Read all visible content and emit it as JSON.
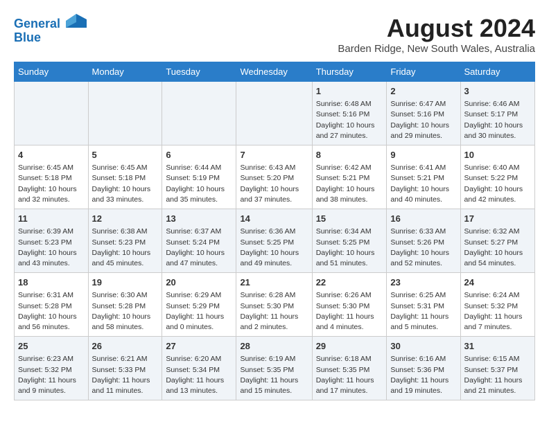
{
  "header": {
    "logo_line1": "General",
    "logo_line2": "Blue",
    "month_year": "August 2024",
    "location": "Barden Ridge, New South Wales, Australia"
  },
  "weekdays": [
    "Sunday",
    "Monday",
    "Tuesday",
    "Wednesday",
    "Thursday",
    "Friday",
    "Saturday"
  ],
  "weeks": [
    [
      {
        "day": "",
        "content": ""
      },
      {
        "day": "",
        "content": ""
      },
      {
        "day": "",
        "content": ""
      },
      {
        "day": "",
        "content": ""
      },
      {
        "day": "1",
        "content": "Sunrise: 6:48 AM\nSunset: 5:16 PM\nDaylight: 10 hours\nand 27 minutes."
      },
      {
        "day": "2",
        "content": "Sunrise: 6:47 AM\nSunset: 5:16 PM\nDaylight: 10 hours\nand 29 minutes."
      },
      {
        "day": "3",
        "content": "Sunrise: 6:46 AM\nSunset: 5:17 PM\nDaylight: 10 hours\nand 30 minutes."
      }
    ],
    [
      {
        "day": "4",
        "content": "Sunrise: 6:45 AM\nSunset: 5:18 PM\nDaylight: 10 hours\nand 32 minutes."
      },
      {
        "day": "5",
        "content": "Sunrise: 6:45 AM\nSunset: 5:18 PM\nDaylight: 10 hours\nand 33 minutes."
      },
      {
        "day": "6",
        "content": "Sunrise: 6:44 AM\nSunset: 5:19 PM\nDaylight: 10 hours\nand 35 minutes."
      },
      {
        "day": "7",
        "content": "Sunrise: 6:43 AM\nSunset: 5:20 PM\nDaylight: 10 hours\nand 37 minutes."
      },
      {
        "day": "8",
        "content": "Sunrise: 6:42 AM\nSunset: 5:21 PM\nDaylight: 10 hours\nand 38 minutes."
      },
      {
        "day": "9",
        "content": "Sunrise: 6:41 AM\nSunset: 5:21 PM\nDaylight: 10 hours\nand 40 minutes."
      },
      {
        "day": "10",
        "content": "Sunrise: 6:40 AM\nSunset: 5:22 PM\nDaylight: 10 hours\nand 42 minutes."
      }
    ],
    [
      {
        "day": "11",
        "content": "Sunrise: 6:39 AM\nSunset: 5:23 PM\nDaylight: 10 hours\nand 43 minutes."
      },
      {
        "day": "12",
        "content": "Sunrise: 6:38 AM\nSunset: 5:23 PM\nDaylight: 10 hours\nand 45 minutes."
      },
      {
        "day": "13",
        "content": "Sunrise: 6:37 AM\nSunset: 5:24 PM\nDaylight: 10 hours\nand 47 minutes."
      },
      {
        "day": "14",
        "content": "Sunrise: 6:36 AM\nSunset: 5:25 PM\nDaylight: 10 hours\nand 49 minutes."
      },
      {
        "day": "15",
        "content": "Sunrise: 6:34 AM\nSunset: 5:25 PM\nDaylight: 10 hours\nand 51 minutes."
      },
      {
        "day": "16",
        "content": "Sunrise: 6:33 AM\nSunset: 5:26 PM\nDaylight: 10 hours\nand 52 minutes."
      },
      {
        "day": "17",
        "content": "Sunrise: 6:32 AM\nSunset: 5:27 PM\nDaylight: 10 hours\nand 54 minutes."
      }
    ],
    [
      {
        "day": "18",
        "content": "Sunrise: 6:31 AM\nSunset: 5:28 PM\nDaylight: 10 hours\nand 56 minutes."
      },
      {
        "day": "19",
        "content": "Sunrise: 6:30 AM\nSunset: 5:28 PM\nDaylight: 10 hours\nand 58 minutes."
      },
      {
        "day": "20",
        "content": "Sunrise: 6:29 AM\nSunset: 5:29 PM\nDaylight: 11 hours\nand 0 minutes."
      },
      {
        "day": "21",
        "content": "Sunrise: 6:28 AM\nSunset: 5:30 PM\nDaylight: 11 hours\nand 2 minutes."
      },
      {
        "day": "22",
        "content": "Sunrise: 6:26 AM\nSunset: 5:30 PM\nDaylight: 11 hours\nand 4 minutes."
      },
      {
        "day": "23",
        "content": "Sunrise: 6:25 AM\nSunset: 5:31 PM\nDaylight: 11 hours\nand 5 minutes."
      },
      {
        "day": "24",
        "content": "Sunrise: 6:24 AM\nSunset: 5:32 PM\nDaylight: 11 hours\nand 7 minutes."
      }
    ],
    [
      {
        "day": "25",
        "content": "Sunrise: 6:23 AM\nSunset: 5:32 PM\nDaylight: 11 hours\nand 9 minutes."
      },
      {
        "day": "26",
        "content": "Sunrise: 6:21 AM\nSunset: 5:33 PM\nDaylight: 11 hours\nand 11 minutes."
      },
      {
        "day": "27",
        "content": "Sunrise: 6:20 AM\nSunset: 5:34 PM\nDaylight: 11 hours\nand 13 minutes."
      },
      {
        "day": "28",
        "content": "Sunrise: 6:19 AM\nSunset: 5:35 PM\nDaylight: 11 hours\nand 15 minutes."
      },
      {
        "day": "29",
        "content": "Sunrise: 6:18 AM\nSunset: 5:35 PM\nDaylight: 11 hours\nand 17 minutes."
      },
      {
        "day": "30",
        "content": "Sunrise: 6:16 AM\nSunset: 5:36 PM\nDaylight: 11 hours\nand 19 minutes."
      },
      {
        "day": "31",
        "content": "Sunrise: 6:15 AM\nSunset: 5:37 PM\nDaylight: 11 hours\nand 21 minutes."
      }
    ]
  ]
}
